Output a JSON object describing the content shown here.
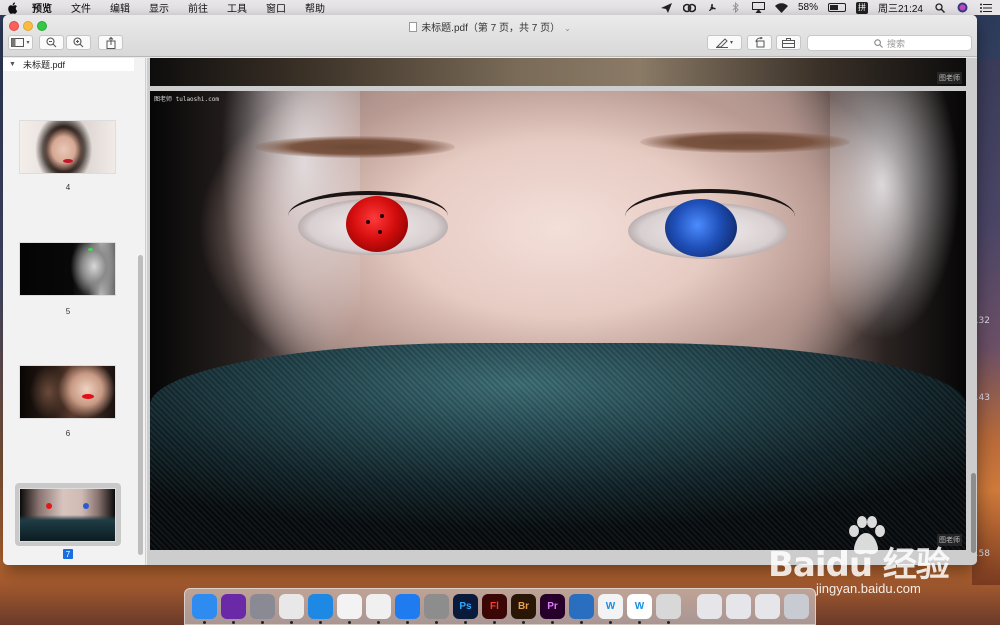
{
  "menubar": {
    "app": "预览",
    "items": [
      "文件",
      "编辑",
      "显示",
      "前往",
      "工具",
      "窗口",
      "帮助"
    ],
    "battery": "58%",
    "battery_level": 0.58,
    "ime_label": "拼",
    "clock": "周三21:24"
  },
  "window": {
    "title": "未标题.pdf（第 7 页，共 7 页）",
    "search_placeholder": "搜索"
  },
  "sidebar": {
    "file_name": "未标题.pdf",
    "thumbnails": [
      {
        "label": "4",
        "selected": false
      },
      {
        "label": "5",
        "selected": false
      },
      {
        "label": "6",
        "selected": false
      },
      {
        "label": "7",
        "selected": true
      }
    ]
  },
  "page": {
    "watermark_small": "图老师 tulaoshi.com",
    "watermark_tag": "图老师"
  },
  "desktop": {
    "edge_numbers": [
      ".32",
      ".43",
      ".58"
    ]
  },
  "dock": {
    "apps": [
      {
        "name": "finder-icon",
        "glyph": "",
        "color": "#2e8cf0"
      },
      {
        "name": "siri-icon",
        "glyph": "",
        "color": "#6a2aa8"
      },
      {
        "name": "launchpad-icon",
        "glyph": "",
        "color": "#8a8a95"
      },
      {
        "name": "chrome-icon",
        "glyph": "",
        "color": "#e8e8e8"
      },
      {
        "name": "safari-icon",
        "glyph": "",
        "color": "#1e88e5"
      },
      {
        "name": "photos-icon",
        "glyph": "",
        "color": "#f3f3f3"
      },
      {
        "name": "qq-icon",
        "glyph": "",
        "color": "#f0f0f0"
      },
      {
        "name": "app-store-icon",
        "glyph": "",
        "color": "#1e7cf0"
      },
      {
        "name": "system-preferences-icon",
        "glyph": "",
        "color": "#8d8d8d"
      },
      {
        "name": "photoshop-icon",
        "glyph": "Ps",
        "color": "#0a1a3a"
      },
      {
        "name": "flash-icon",
        "glyph": "Fl",
        "color": "#3a0606"
      },
      {
        "name": "bridge-icon",
        "glyph": "Br",
        "color": "#2a1606"
      },
      {
        "name": "premiere-icon",
        "glyph": "Pr",
        "color": "#26002a"
      },
      {
        "name": "browser-icon",
        "glyph": "",
        "color": "#2a6ec0"
      },
      {
        "name": "word-icon",
        "glyph": "W",
        "color": "#f3f3f3"
      },
      {
        "name": "w-app-icon",
        "glyph": "W",
        "color": "#ffffff"
      },
      {
        "name": "preview-icon",
        "glyph": "",
        "color": "#d8d8d8"
      },
      {
        "name": "mail-icon",
        "glyph": "",
        "color": "#e6e6ea"
      },
      {
        "name": "document-icon",
        "glyph": "",
        "color": "#e6e6ea"
      },
      {
        "name": "screen-icon",
        "glyph": "",
        "color": "#e6e6ea"
      },
      {
        "name": "trash-icon",
        "glyph": "",
        "color": "#c8ccd2"
      }
    ]
  },
  "watermark": {
    "brand": "Baidu 经验",
    "url": "jingyan.baidu.com"
  }
}
